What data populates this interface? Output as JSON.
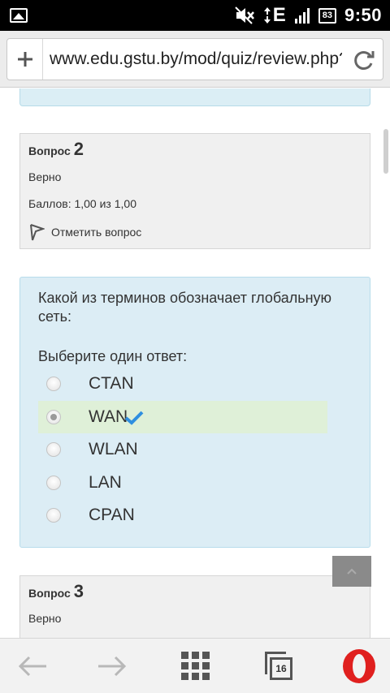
{
  "status_bar": {
    "network_label": "E",
    "battery": "83",
    "time": "9:50"
  },
  "address_bar": {
    "url": "www.edu.gstu.by/mod/quiz/review.php?atte"
  },
  "question2_info": {
    "title_label": "Вопрос",
    "number": "2",
    "status": "Верно",
    "grade": "Баллов: 1,00 из 1,00",
    "flag_label": "Отметить вопрос"
  },
  "question2": {
    "text": "Какой из терминов обозначает глобальную сеть:",
    "prompt": "Выберите один ответ:",
    "answers": [
      {
        "label": "CTAN",
        "selected": false,
        "correct": false
      },
      {
        "label": "WAN",
        "selected": true,
        "correct": true
      },
      {
        "label": "WLAN",
        "selected": false,
        "correct": false
      },
      {
        "label": "LAN",
        "selected": false,
        "correct": false
      },
      {
        "label": "CPAN",
        "selected": false,
        "correct": false
      }
    ]
  },
  "question3_info": {
    "title_label": "Вопрос",
    "number": "3",
    "status": "Верно"
  },
  "bottom_bar": {
    "tab_count": "16"
  },
  "colors": {
    "question_bg": "#dcedf5",
    "correct_bg": "#dff0d8",
    "info_bg": "#f0f0f0",
    "check_color": "#2f8fe0",
    "opera_red": "#e0201f"
  },
  "icons": [
    "image-notification-icon",
    "mute-icon",
    "network-e-icon",
    "signal-icon",
    "battery-icon",
    "plus-icon",
    "reload-icon",
    "flag-icon",
    "checkmark-icon",
    "up-arrow-icon",
    "back-arrow-icon",
    "forward-arrow-icon",
    "speed-dial-grid-icon",
    "tabs-icon",
    "opera-logo-icon"
  ]
}
